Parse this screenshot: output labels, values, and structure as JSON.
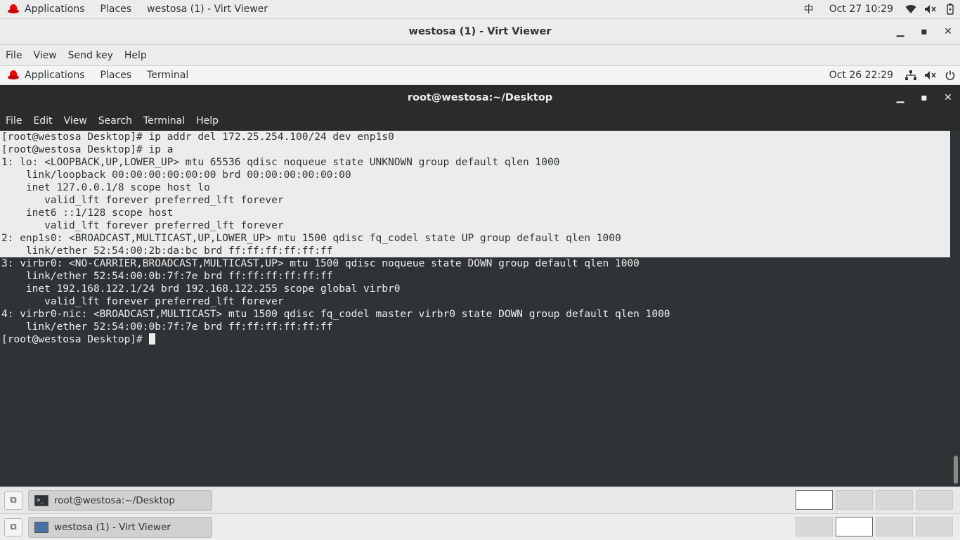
{
  "host_topbar": {
    "applications": "Applications",
    "places": "Places",
    "active_window": "westosa (1) - Virt Viewer",
    "input_method": "中",
    "date": "Oct 27",
    "time": "10:29"
  },
  "virt_viewer": {
    "title": "westosa (1) - Virt Viewer",
    "menu": [
      "File",
      "View",
      "Send key",
      "Help"
    ]
  },
  "guest_topbar": {
    "applications": "Applications",
    "places": "Places",
    "active_app": "Terminal",
    "date": "Oct 26",
    "time": "22:29"
  },
  "terminal": {
    "title": "root@westosa:~/Desktop",
    "menu": [
      "File",
      "Edit",
      "View",
      "Search",
      "Terminal",
      "Help"
    ],
    "lines": [
      "[root@westosa Desktop]# ip addr del 172.25.254.100/24 dev enp1s0",
      "[root@westosa Desktop]# ip a",
      "1: lo: <LOOPBACK,UP,LOWER_UP> mtu 65536 qdisc noqueue state UNKNOWN group default qlen 1000",
      "    link/loopback 00:00:00:00:00:00 brd 00:00:00:00:00:00",
      "    inet 127.0.0.1/8 scope host lo",
      "       valid_lft forever preferred_lft forever",
      "    inet6 ::1/128 scope host",
      "       valid_lft forever preferred_lft forever",
      "2: enp1s0: <BROADCAST,MULTICAST,UP,LOWER_UP> mtu 1500 qdisc fq_codel state UP group default qlen 1000",
      "    link/ether 52:54:00:2b:da:bc brd ff:ff:ff:ff:ff:ff",
      "3: virbr0: <NO-CARRIER,BROADCAST,MULTICAST,UP> mtu 1500 qdisc noqueue state DOWN group default qlen 1000",
      "    link/ether 52:54:00:0b:7f:7e brd ff:ff:ff:ff:ff:ff",
      "    inet 192.168.122.1/24 brd 192.168.122.255 scope global virbr0",
      "       valid_lft forever preferred_lft forever",
      "4: virbr0-nic: <BROADCAST,MULTICAST> mtu 1500 qdisc fq_codel master virbr0 state DOWN group default qlen 1000",
      "    link/ether 52:54:00:0b:7f:7e brd ff:ff:ff:ff:ff:ff",
      "[root@westosa Desktop]# "
    ],
    "selected_through_line_index": 9
  },
  "guest_taskbar": {
    "task_label": "root@westosa:~/Desktop"
  },
  "host_taskbar": {
    "task_label": "westosa (1) - Virt Viewer"
  },
  "icons": {
    "redhat": "redhat-logo",
    "wifi": "wifi-icon",
    "volume": "volume-muted-icon",
    "battery": "battery-icon",
    "network": "network-icon",
    "power": "power-icon"
  }
}
